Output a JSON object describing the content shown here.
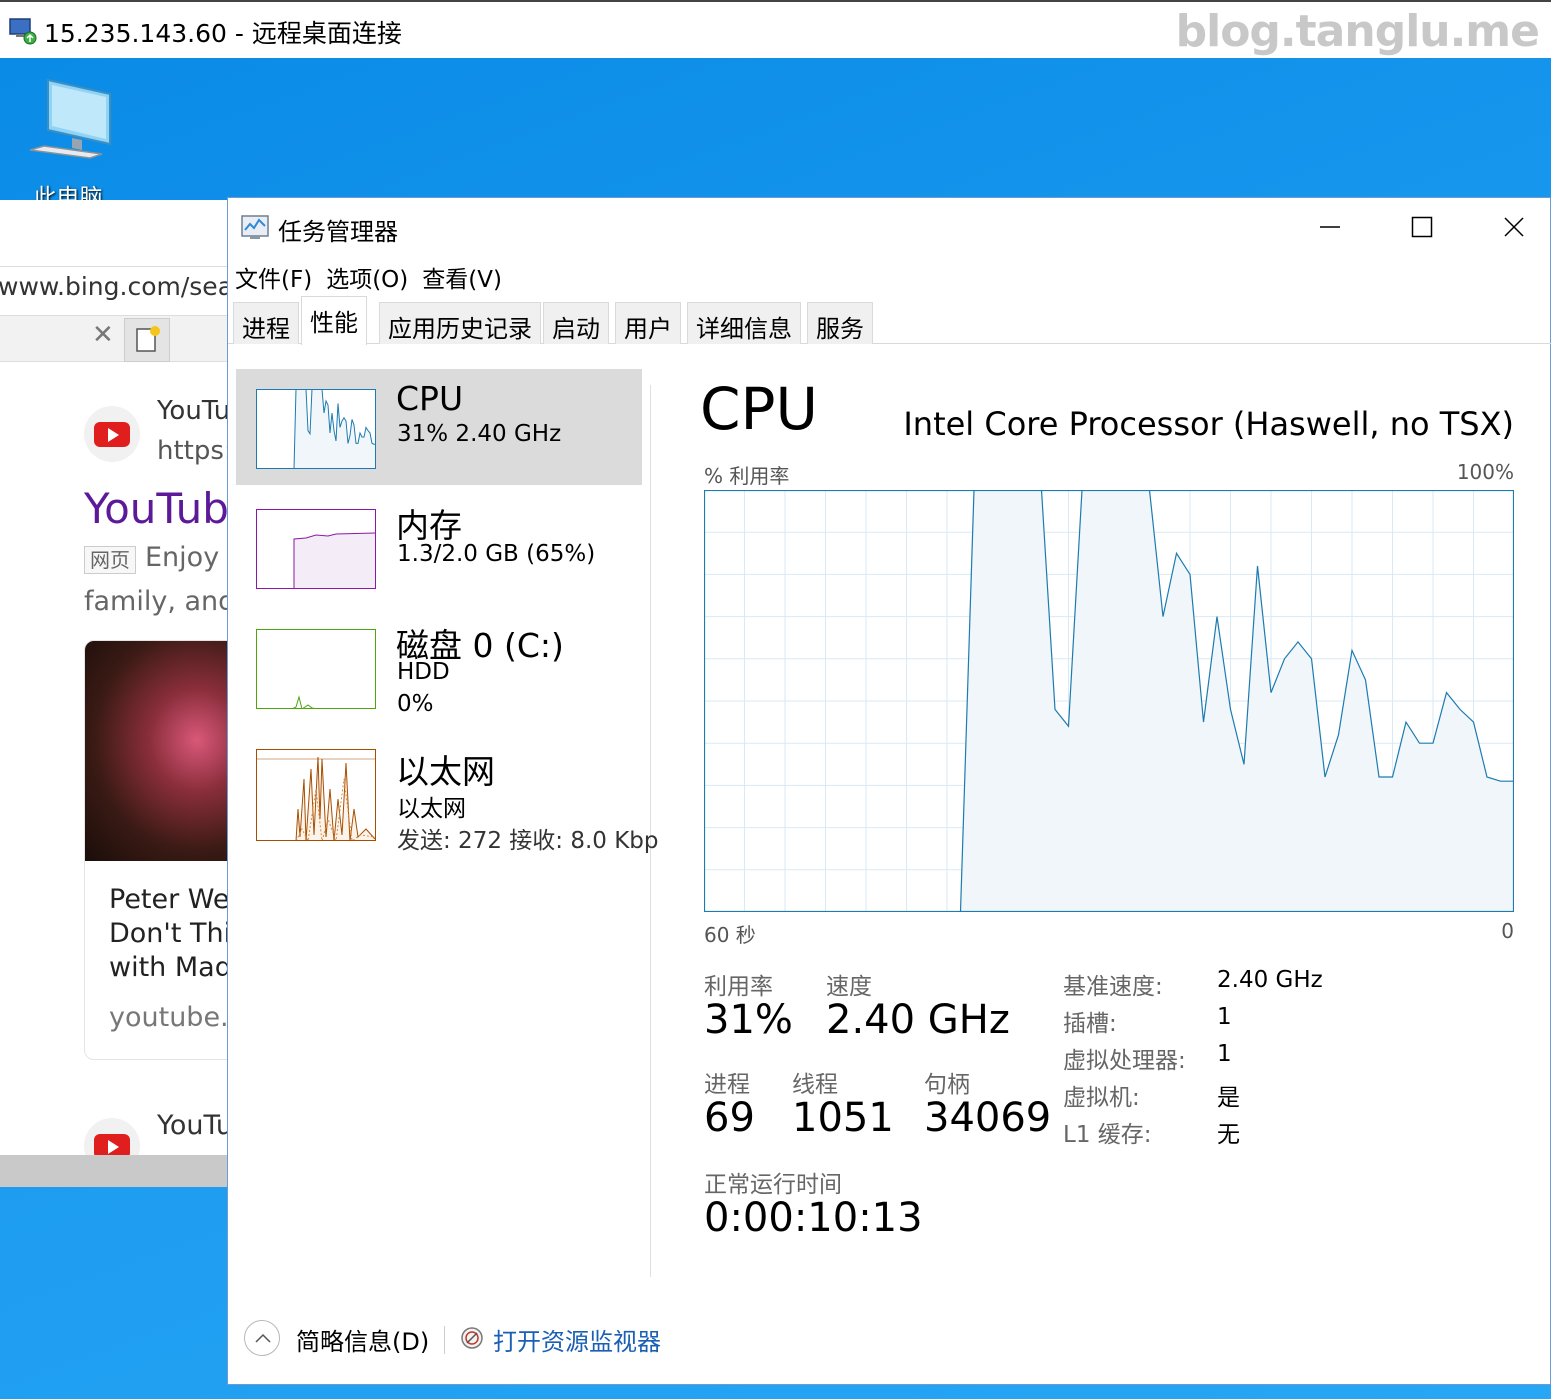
{
  "remote_desktop": {
    "title": "15.235.143.60 - 远程桌面连接",
    "watermark": "blog.tanglu.me"
  },
  "desktop": {
    "icon_label": "此电脑"
  },
  "browser": {
    "address": "www.bing.com/searc",
    "result1": {
      "site": "YouTu",
      "url": "https:/",
      "heading": "YouTub",
      "badge": "网页",
      "snippet_line1": "Enjoy t",
      "snippet_line2": "family, and"
    },
    "card": {
      "line1": "Peter We",
      "line2": "Don't Thir",
      "line3": "with Madi",
      "source": "youtube.c"
    },
    "result2": {
      "site": "YouTu"
    }
  },
  "task_manager": {
    "title": "任务管理器",
    "menu": [
      "文件(F)",
      "选项(O)",
      "查看(V)"
    ],
    "tabs": [
      "进程",
      "性能",
      "应用历史记录",
      "启动",
      "用户",
      "详细信息",
      "服务"
    ],
    "active_tab": "性能",
    "resources": [
      {
        "title": "CPU",
        "sub1": "31%  2.40 GHz",
        "color": "#1c7bb0",
        "fill": "#f1f6fb"
      },
      {
        "title": "内存",
        "sub1": "1.3/2.0 GB (65%)",
        "color": "#8b18a8",
        "fill": "#f4ecf6"
      },
      {
        "title": "磁盘 0 (C:)",
        "sub1": "HDD",
        "sub2": "0%",
        "color": "#4da60c",
        "fill": "#eff7e8"
      },
      {
        "title": "以太网",
        "sub1": "以太网",
        "sub2": "发送: 272 接收: 8.0 Kbp",
        "color": "#a74f01",
        "fill": "#fcf3ea"
      }
    ],
    "cpu_detail": {
      "heading": "CPU",
      "model": "Intel Core Processor (Haswell, no TSX)",
      "graph_label": "% 利用率",
      "graph_max": "100%",
      "time_left": "60 秒",
      "time_right": "0",
      "utilization_label": "利用率",
      "utilization": "31%",
      "speed_label": "速度",
      "speed": "2.40 GHz",
      "processes_label": "进程",
      "processes": "69",
      "threads_label": "线程",
      "threads": "1051",
      "handles_label": "句柄",
      "handles": "34069",
      "uptime_label": "正常运行时间",
      "uptime": "0:00:10:13",
      "specs": [
        {
          "key": "基准速度:",
          "value": "2.40 GHz"
        },
        {
          "key": "插槽:",
          "value": "1"
        },
        {
          "key": "虚拟处理器:",
          "value": "1"
        },
        {
          "key": "虚拟机:",
          "value": "是"
        },
        {
          "key": "L1 缓存:",
          "value": "无"
        }
      ],
      "line_color": "#1c7bb0",
      "fill_color": "#f1f6fb"
    },
    "chart_data": {
      "type": "area",
      "x": [
        0,
        1,
        2,
        3,
        4,
        5,
        6,
        7,
        8,
        9,
        10,
        11,
        12,
        13,
        14,
        15,
        16,
        17,
        18,
        19,
        20,
        21,
        22,
        23,
        24,
        25,
        26,
        27,
        28,
        29,
        30,
        31,
        32,
        33,
        34,
        35,
        36,
        37,
        38,
        39,
        40,
        41,
        42,
        43,
        44,
        45,
        46,
        47,
        48,
        49,
        50,
        51,
        52,
        53,
        54,
        55,
        56,
        57,
        58,
        59,
        60
      ],
      "values": [
        0,
        0,
        0,
        0,
        0,
        0,
        0,
        0,
        0,
        0,
        0,
        0,
        0,
        0,
        0,
        0,
        0,
        0,
        0,
        0,
        100,
        100,
        100,
        100,
        100,
        100,
        48,
        44,
        100,
        100,
        100,
        100,
        100,
        100,
        70,
        85,
        80,
        45,
        70,
        48,
        35,
        82,
        52,
        60,
        64,
        60,
        32,
        42,
        62,
        55,
        32,
        32,
        45,
        40,
        40,
        52,
        48,
        45,
        32,
        31,
        31
      ],
      "xlabel": "60 秒",
      "ylabel": "% 利用率",
      "ylim": [
        0,
        100
      ],
      "grid": true
    }
  },
  "footer": {
    "fewer_details": "简略信息(D)",
    "resource_monitor": "打开资源监视器"
  }
}
